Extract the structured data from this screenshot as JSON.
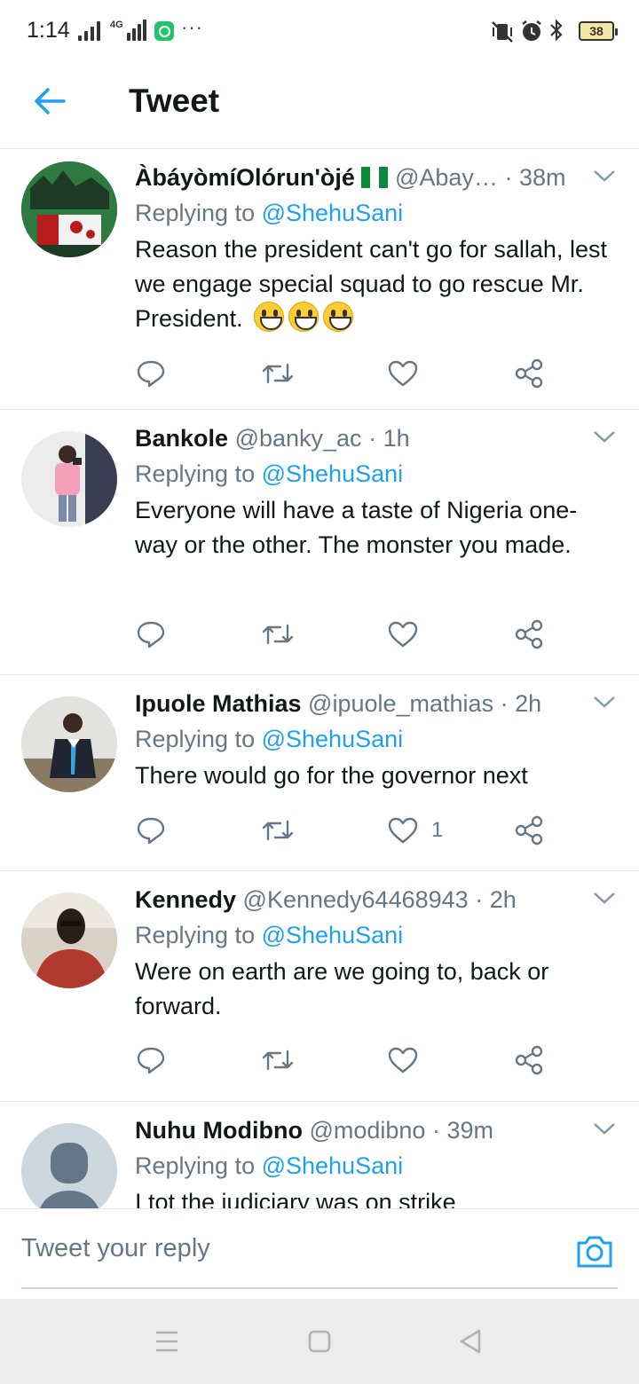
{
  "status_bar": {
    "time": "1:14",
    "network_label": "4G",
    "more": "···",
    "battery": "38"
  },
  "header": {
    "title": "Tweet"
  },
  "replying_prefix": "Replying to",
  "tweets": [
    {
      "name": "ÀbáyòmíOlórun'òjé",
      "handle": "@Abay…",
      "separator": "·",
      "time": "38m",
      "replying_to": "@ShehuSani",
      "text": "Reason the president can't go for sallah, lest we engage special squad to go rescue Mr. President.",
      "like_count": ""
    },
    {
      "name": "Bankole",
      "handle": "@banky_ac",
      "separator": "·",
      "time": "1h",
      "replying_to": "@ShehuSani",
      "text": "Everyone will have a taste of Nigeria one-way or the other. The monster you made.",
      "like_count": ""
    },
    {
      "name": "Ipuole Mathias",
      "handle": "@ipuole_mathias",
      "separator": "·",
      "time": "2h",
      "replying_to": "@ShehuSani",
      "text": "There would go for the governor next",
      "like_count": "1"
    },
    {
      "name": "Kennedy",
      "handle": "@Kennedy64468943",
      "separator": "·",
      "time": "2h",
      "replying_to": "@ShehuSani",
      "text": "Were on earth are we going to, back or forward.",
      "like_count": ""
    },
    {
      "name": "Nuhu Modibno",
      "handle": "@modibno",
      "separator": "·",
      "time": "39m",
      "replying_to": "@ShehuSani",
      "text": "I tot the judiciary was on strike",
      "like_count": ""
    }
  ],
  "compose": {
    "placeholder": "Tweet your reply"
  },
  "colors": {
    "accent": "#1da1f2",
    "secondary_text": "#657786",
    "divider": "#e1e8ed"
  },
  "icons": [
    "back-arrow-icon",
    "caret-down-icon",
    "reply-icon",
    "retweet-icon",
    "like-icon",
    "share-icon",
    "camera-icon",
    "nigeria-flag-icon",
    "grinning-emoji-icon"
  ]
}
